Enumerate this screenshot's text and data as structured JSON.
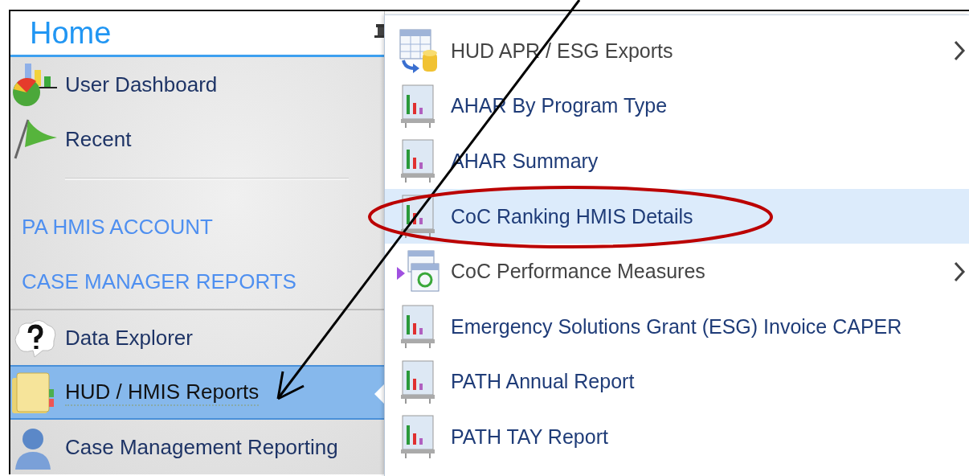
{
  "sidebar": {
    "title": "Home",
    "items": [
      {
        "kind": "nav",
        "label": "User Dashboard",
        "selected": false
      },
      {
        "kind": "nav",
        "label": "Recent",
        "selected": false
      },
      {
        "kind": "link",
        "label": "PA HMIS ACCOUNT",
        "selected": false
      },
      {
        "kind": "link",
        "label": "CASE MANAGER REPORTS",
        "selected": false
      },
      {
        "kind": "nav",
        "label": "Data Explorer",
        "selected": false
      },
      {
        "kind": "nav",
        "label": "HUD / HMIS Reports",
        "selected": true
      },
      {
        "kind": "nav",
        "label": "Case Management Reporting",
        "selected": false
      }
    ]
  },
  "menu": {
    "items": [
      {
        "kind": "submenu",
        "label": "HUD APR / ESG Exports",
        "selected": false
      },
      {
        "kind": "report",
        "label": "AHAR By Program Type",
        "selected": false
      },
      {
        "kind": "report",
        "label": "AHAR Summary",
        "selected": false
      },
      {
        "kind": "report",
        "label": "CoC Ranking HMIS Details",
        "selected": true
      },
      {
        "kind": "submenu",
        "label": "CoC Performance Measures",
        "selected": false
      },
      {
        "kind": "report",
        "label": "Emergency Solutions Grant (ESG) Invoice CAPER",
        "selected": false
      },
      {
        "kind": "report",
        "label": "PATH Annual Report",
        "selected": false
      },
      {
        "kind": "report",
        "label": "PATH TAY Report",
        "selected": false
      }
    ]
  },
  "annotations": [
    {
      "kind": "arrow"
    },
    {
      "kind": "ellipse"
    }
  ]
}
